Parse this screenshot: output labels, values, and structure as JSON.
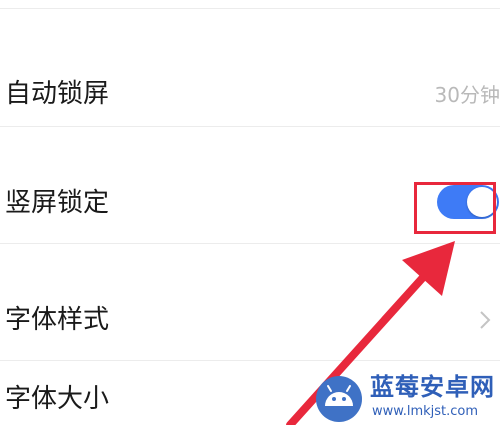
{
  "settings": {
    "auto_lock": {
      "label": "自动锁屏",
      "value": "30分钟"
    },
    "portrait_lock": {
      "label": "竖屏锁定",
      "toggle_on": true
    },
    "font_style": {
      "label": "字体样式"
    },
    "font_size": {
      "label": "字体大小"
    }
  },
  "icons": {
    "chevron": "chevron-right-icon"
  },
  "colors": {
    "toggle_on": "#3e7bf6",
    "highlight": "#e8283c",
    "label_text": "#1a1a1a",
    "value_text": "#b9b9b9",
    "watermark": "#2f5fb8"
  },
  "watermark": {
    "title": "蓝莓安卓网",
    "url": "www.lmkjst.com"
  }
}
